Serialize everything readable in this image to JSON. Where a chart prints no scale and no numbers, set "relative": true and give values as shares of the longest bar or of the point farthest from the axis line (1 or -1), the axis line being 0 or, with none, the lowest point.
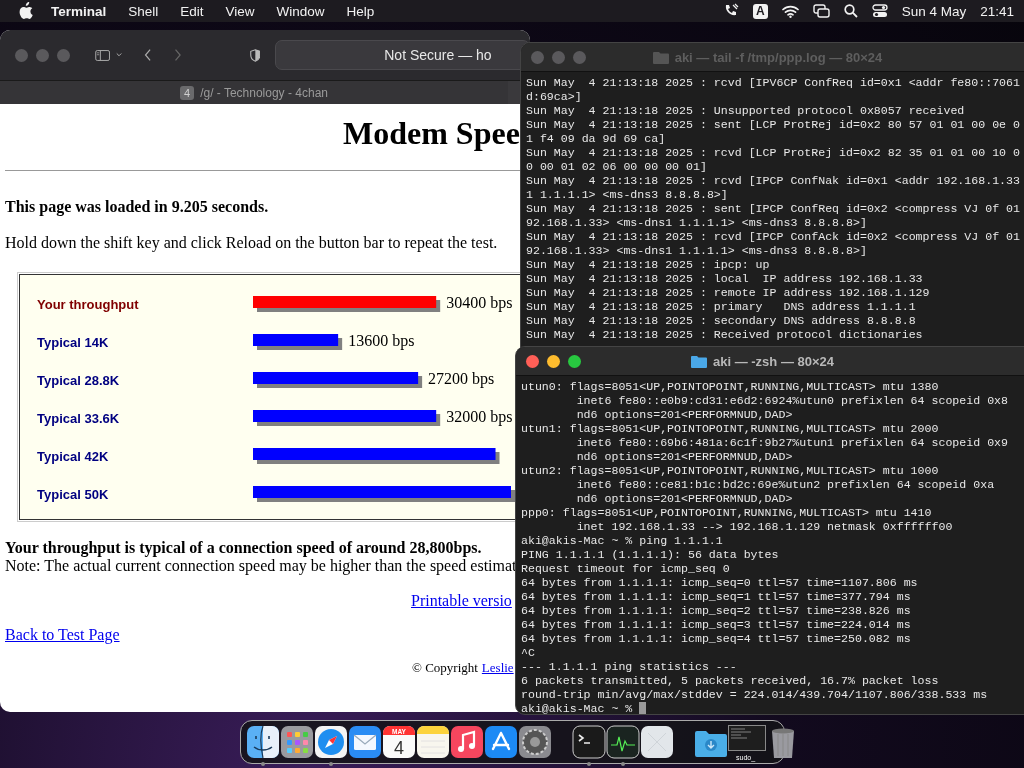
{
  "menu_bar": {
    "app_name": "Terminal",
    "menus": [
      "Shell",
      "Edit",
      "View",
      "Window",
      "Help"
    ],
    "input_source": "A",
    "date": "Sun 4 May",
    "time": "21:41"
  },
  "browser": {
    "address": "Not Secure — ho",
    "tabs": [
      {
        "badge": "4",
        "title": "/g/ - Technology - 4chan",
        "selected": false
      }
    ],
    "page": {
      "heading": "Modem Spee",
      "load_time": "This page was loaded in 9.205 seconds.",
      "instruction": "Hold down the shift key and click Reload on the button bar to repeat the test.",
      "chart_data": {
        "type": "bar",
        "orientation": "horizontal",
        "stacked": true,
        "categories": [
          "Your throughput",
          "Typical 14K",
          "Typical 28.8K",
          "Typical 33.6K",
          "Typical 42K",
          "Typical 50K"
        ],
        "relative": true,
        "series": [
          {
            "color": "#ff0000",
            "values": [
              0.71,
              null,
              null,
              null,
              null,
              null
            ]
          },
          {
            "color": "#0000ff",
            "values": [
              null,
              0.33,
              0.64,
              0.71,
              0.94,
              1
            ]
          }
        ],
        "value_labels": [
          "30400 bps",
          "13600 bps",
          "27200 bps",
          "32000 bps",
          null,
          null
        ]
      },
      "verdict": "Your throughput is typical of a connection speed of around 28,800bps.",
      "note": "Note: The actual current connection speed may be higher than the speed estimat",
      "printable_link": "Printable versio",
      "back_link": "Back to Test Page",
      "copyright": "© Copyright",
      "author_link": "Leslie"
    }
  },
  "terminals": [
    {
      "title": "aki — tail -f /tmp/ppp.log — 80×24",
      "active": false,
      "cursor": false,
      "lines": [
        "Sun May  4 21:13:18 2025 : rcvd [IPV6CP ConfReq id=0x1 <addr fe80::7061",
        "d:69ca>]",
        "Sun May  4 21:13:18 2025 : Unsupported protocol 0x8057 received",
        "Sun May  4 21:13:18 2025 : sent [LCP ProtRej id=0x2 80 57 01 01 00 0e 0",
        "1 f4 09 da 9d 69 ca]",
        "Sun May  4 21:13:18 2025 : rcvd [LCP ProtRej id=0x2 82 35 01 01 00 10 0",
        "0 00 01 02 06 00 00 00 01]",
        "Sun May  4 21:13:18 2025 : rcvd [IPCP ConfNak id=0x1 <addr 192.168.1.33",
        "1 1.1.1.1> <ms-dns3 8.8.8.8>]",
        "Sun May  4 21:13:18 2025 : sent [IPCP ConfReq id=0x2 <compress VJ 0f 01",
        "92.168.1.33> <ms-dns1 1.1.1.1> <ms-dns3 8.8.8.8>]",
        "Sun May  4 21:13:18 2025 : rcvd [IPCP ConfAck id=0x2 <compress VJ 0f 01",
        "92.168.1.33> <ms-dns1 1.1.1.1> <ms-dns3 8.8.8.8>]",
        "Sun May  4 21:13:18 2025 : ipcp: up",
        "Sun May  4 21:13:18 2025 : local  IP address 192.168.1.33",
        "Sun May  4 21:13:18 2025 : remote IP address 192.168.1.129",
        "Sun May  4 21:13:18 2025 : primary   DNS address 1.1.1.1",
        "Sun May  4 21:13:18 2025 : secondary DNS address 8.8.8.8",
        "Sun May  4 21:13:18 2025 : Received protocol dictionaries"
      ]
    },
    {
      "title": "aki — -zsh — 80×24",
      "active": true,
      "cursor": true,
      "lines": [
        "utun0: flags=8051<UP,POINTOPOINT,RUNNING,MULTICAST> mtu 1380",
        "        inet6 fe80::e0b9:cd31:e6d2:6924%utun0 prefixlen 64 scopeid 0x8",
        "        nd6 options=201<PERFORMNUD,DAD>",
        "utun1: flags=8051<UP,POINTOPOINT,RUNNING,MULTICAST> mtu 2000",
        "        inet6 fe80::69b6:481a:6c1f:9b27%utun1 prefixlen 64 scopeid 0x9",
        "        nd6 options=201<PERFORMNUD,DAD>",
        "utun2: flags=8051<UP,POINTOPOINT,RUNNING,MULTICAST> mtu 1000",
        "        inet6 fe80::ce81:b1c:bd2c:69e%utun2 prefixlen 64 scopeid 0xa",
        "        nd6 options=201<PERFORMNUD,DAD>",
        "ppp0: flags=8051<UP,POINTOPOINT,RUNNING,MULTICAST> mtu 1410",
        "        inet 192.168.1.33 --> 192.168.1.129 netmask 0xffffff00",
        "aki@akis-Mac ~ % ping 1.1.1.1",
        "PING 1.1.1.1 (1.1.1.1): 56 data bytes",
        "Request timeout for icmp_seq 0",
        "64 bytes from 1.1.1.1: icmp_seq=0 ttl=57 time=1107.806 ms",
        "64 bytes from 1.1.1.1: icmp_seq=1 ttl=57 time=377.794 ms",
        "64 bytes from 1.1.1.1: icmp_seq=2 ttl=57 time=238.826 ms",
        "64 bytes from 1.1.1.1: icmp_seq=3 ttl=57 time=224.014 ms",
        "64 bytes from 1.1.1.1: icmp_seq=4 ttl=57 time=250.082 ms",
        "^C",
        "--- 1.1.1.1 ping statistics ---",
        "6 packets transmitted, 5 packets received, 16.7% packet loss",
        "round-trip min/avg/max/stddev = 224.014/439.704/1107.806/338.533 ms",
        "aki@akis-Mac ~ % "
      ]
    }
  ],
  "dock": {
    "items": [
      {
        "kind": "finder",
        "running": true
      },
      {
        "kind": "launchpad",
        "running": false
      },
      {
        "kind": "safari",
        "running": true
      },
      {
        "kind": "mail",
        "running": false
      },
      {
        "kind": "calendar",
        "running": false,
        "month": "MAY",
        "day": "4"
      },
      {
        "kind": "notes",
        "running": false
      },
      {
        "kind": "music",
        "running": false
      },
      {
        "kind": "appstore",
        "running": false
      },
      {
        "kind": "settings",
        "running": false
      },
      {
        "kind": "separator"
      },
      {
        "kind": "terminal",
        "running": true
      },
      {
        "kind": "activity",
        "running": true
      },
      {
        "kind": "blank",
        "running": false
      },
      {
        "kind": "separator"
      },
      {
        "kind": "downloads"
      },
      {
        "kind": "minimized",
        "label": "sudo_"
      },
      {
        "kind": "trash"
      }
    ]
  }
}
